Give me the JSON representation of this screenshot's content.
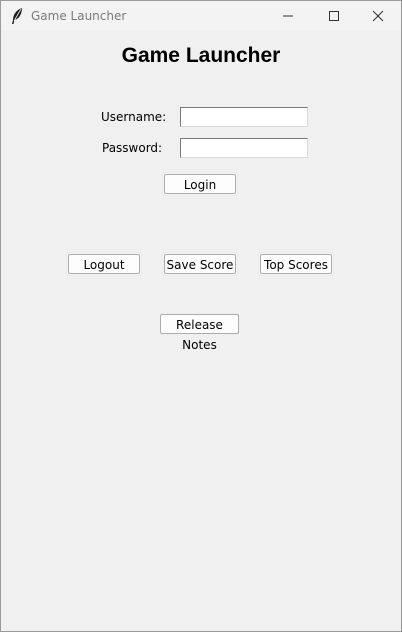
{
  "window": {
    "title": "Game Launcher",
    "icon": "feather-icon",
    "controls": [
      "minimize-icon",
      "maximize-icon",
      "close-icon"
    ]
  },
  "main": {
    "heading": "Game Launcher",
    "username_label": "Username:",
    "username_value": "",
    "password_label": "Password:",
    "password_value": "",
    "login_label": "Login",
    "logout_label": "Logout",
    "save_score_label": "Save Score",
    "top_scores_label": "Top Scores",
    "release_notes_label": "Release Notes"
  }
}
